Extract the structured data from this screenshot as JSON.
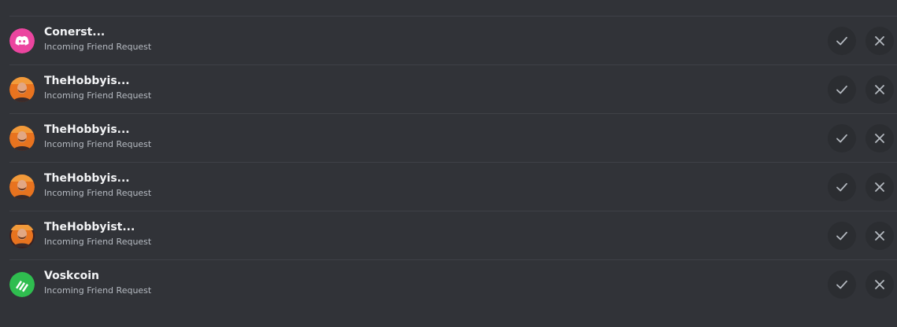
{
  "requests": [
    {
      "name": "Conerst...",
      "subtitle": "Incoming Friend Request",
      "avatar": "discord-logo",
      "avatar_color": "#eb459f"
    },
    {
      "name": "TheHobbyis...",
      "subtitle": "Incoming Friend Request",
      "avatar": "user-photo",
      "avatar_color": "#e8731f"
    },
    {
      "name": "TheHobbyis...",
      "subtitle": "Incoming Friend Request",
      "avatar": "user-photo",
      "avatar_color": "#e8731f"
    },
    {
      "name": "TheHobbyis...",
      "subtitle": "Incoming Friend Request",
      "avatar": "user-photo",
      "avatar_color": "#e8731f"
    },
    {
      "name": "TheHobbyist...",
      "subtitle": "Incoming Friend Request",
      "avatar": "user-photo",
      "avatar_color": "#e8731f"
    },
    {
      "name": "Voskcoin",
      "subtitle": "Incoming Friend Request",
      "avatar": "voskcoin-logo",
      "avatar_color": "#2fbd4f"
    }
  ],
  "icons": {
    "accept": "check-icon",
    "decline": "close-icon"
  },
  "colors": {
    "background": "#313338",
    "button_bg": "#2b2d31",
    "divider": "#3f4147",
    "name_text": "#f2f3f5",
    "sub_text": "#b5bac1"
  }
}
